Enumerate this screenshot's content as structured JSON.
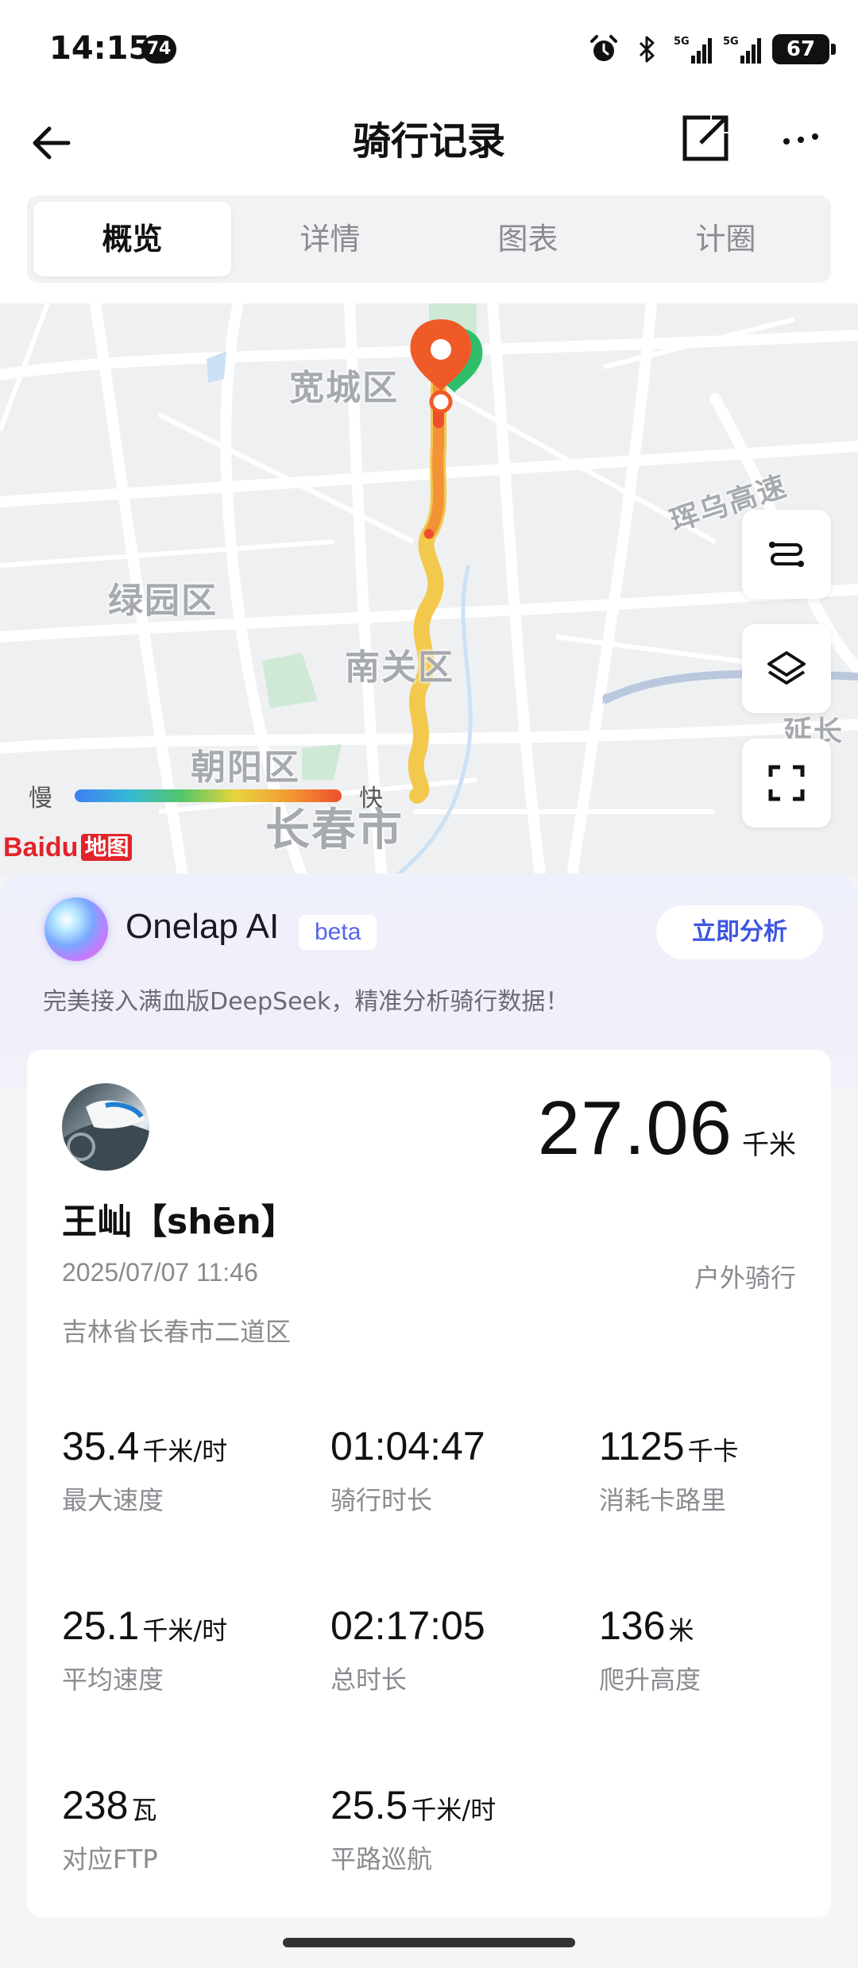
{
  "status_bar": {
    "time": "14:15",
    "notification_badge": "74",
    "network1": "5G",
    "network2": "5G",
    "battery": "67",
    "icons": [
      "alarm-icon",
      "bluetooth-icon",
      "signal-icon",
      "signal-icon"
    ]
  },
  "header": {
    "title": "骑行记录",
    "icons": [
      "back-arrow-icon",
      "share-icon",
      "more-icon"
    ]
  },
  "tabs": [
    {
      "label": "概览",
      "active": true
    },
    {
      "label": "详情",
      "active": false
    },
    {
      "label": "图表",
      "active": false
    },
    {
      "label": "计圈",
      "active": false
    }
  ],
  "map": {
    "labels": {
      "kuancheng": "宽城区",
      "lvyuan": "绿园区",
      "nanguan": "南关区",
      "chaoyang": "朝阳区",
      "changchun": "长春市",
      "hunwu": "珲乌高速",
      "yanchang": "延长"
    },
    "legend": {
      "slow": "慢",
      "fast": "快"
    },
    "provider": {
      "brand": "Baidu",
      "suffix": "地图"
    },
    "controls": [
      "route-icon",
      "layers-icon",
      "fullscreen-icon"
    ],
    "colors": {
      "route_slow": "#f2c94c",
      "route_fast": "#ee4e2e",
      "pin": "#f05a28"
    }
  },
  "ai": {
    "name": "Onelap AI",
    "tag": "beta",
    "button": "立即分析",
    "description": "完美接入满血版DeepSeek，精准分析骑行数据！"
  },
  "ride": {
    "distance": "27.06",
    "distance_unit": "千米",
    "user": "王屾【shēn】",
    "datetime": "2025/07/07 11:46",
    "type": "户外骑行",
    "location": "吉林省长春市二道区",
    "stats": [
      {
        "value": "35.4",
        "unit": "千米/时",
        "label": "最大速度"
      },
      {
        "value": "01:04:47",
        "unit": "",
        "label": "骑行时长"
      },
      {
        "value": "1125",
        "unit": "千卡",
        "label": "消耗卡路里"
      },
      {
        "value": "25.1",
        "unit": "千米/时",
        "label": "平均速度"
      },
      {
        "value": "02:17:05",
        "unit": "",
        "label": "总时长"
      },
      {
        "value": "136",
        "unit": "米",
        "label": "爬升高度"
      },
      {
        "value": "238",
        "unit": "瓦",
        "label": "对应FTP"
      },
      {
        "value": "25.5",
        "unit": "千米/时",
        "label": "平路巡航"
      }
    ]
  }
}
